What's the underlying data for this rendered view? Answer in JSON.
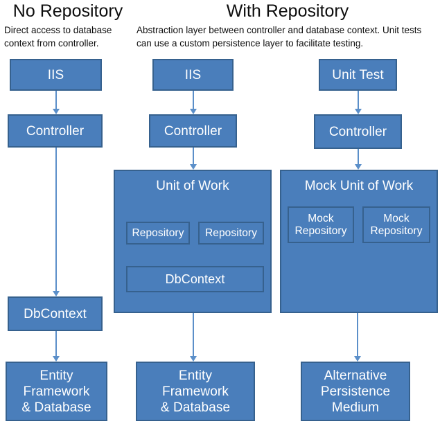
{
  "diagram": {
    "columns": [
      {
        "title": "No Repository",
        "subtitle": "Direct access to database context from controller."
      },
      {
        "title": "With Repository",
        "subtitle": "Abstraction layer between controller and database context. Unit tests can use a custom persistence layer to facilitate testing."
      }
    ],
    "colors": {
      "box_fill": "#4a7ebb",
      "box_border": "#36618e",
      "connector": "#5b8fc9",
      "box_text": "#ffffff",
      "heading_text": "#0d0d0d",
      "background": "#ffffff"
    },
    "column1": {
      "iis": "IIS",
      "controller": "Controller",
      "dbcontext": "DbContext",
      "entity_framework": "Entity\nFramework\n& Database"
    },
    "column2": {
      "iis": "IIS",
      "controller": "Controller",
      "unit_of_work": "Unit of Work",
      "repository_left": "Repository",
      "repository_right": "Repository",
      "dbcontext": "DbContext",
      "entity_framework": "Entity\nFramework\n& Database"
    },
    "column3": {
      "unit_test": "Unit Test",
      "controller": "Controller",
      "mock_unit_of_work": "Mock Unit of Work",
      "mock_repository_left": "Mock\nRepository",
      "mock_repository_right": "Mock\nRepository",
      "alternative_persistence": "Alternative\nPersistence\nMedium"
    }
  }
}
